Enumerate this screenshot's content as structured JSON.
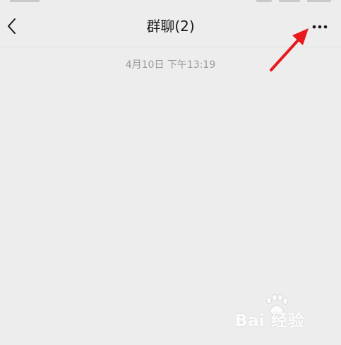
{
  "nav": {
    "title": "群聊(2)",
    "back_icon": "chevron-left-icon",
    "more_icon": "more-horizontal-icon"
  },
  "chat": {
    "timestamp": "4月10日 下午13:19"
  },
  "annotation": {
    "color": "#e8191c",
    "points_to": "more-button"
  },
  "watermark": {
    "text": "Bai 经验",
    "logo_icon": "paw-icon"
  },
  "colors": {
    "background": "#ededed",
    "title": "#191919",
    "timestamp": "#9b9b9b"
  }
}
